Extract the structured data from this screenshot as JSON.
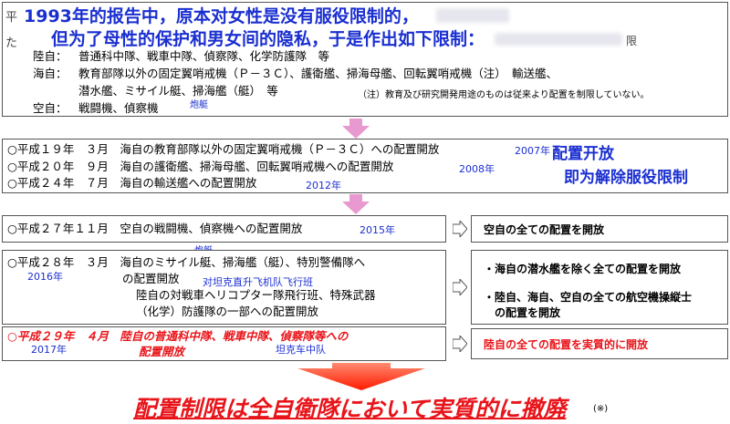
{
  "header": {
    "line1_prefix": "平",
    "line1": "1993年的报告中，原本对女性是没有服役限制的，",
    "line2_prefix": "た",
    "line2": "但为了母性的保护和男女间的隐私，于是作出如下限制：",
    "line2_suffix": "限"
  },
  "restrictions": [
    {
      "branch": "陸自：",
      "text": "普通科中隊、戦車中隊、偵察隊、化学防護隊　等"
    },
    {
      "branch": "海自：",
      "text": "教育部隊以外の固定翼哨戒機（Ｐ－３Ｃ）、護衛艦、掃海母艦、回転翼哨戒機（注）　輸送艦、"
    },
    {
      "branch": "",
      "text": "潜水艦、ミサイル艇、掃海艦（艇）　等"
    },
    {
      "branch": "空自：",
      "text": "戦闘機、偵察機"
    }
  ],
  "restriction_note": "（注）教育及び研究開発用途のものは従来より配置を制限していない。",
  "annotation_hoting1": "炮艇",
  "phase1": {
    "items": [
      {
        "label": "○平成１９年　３月　海自の教育部隊以外の固定翼哨戒機（Ｐ－３Ｃ）への配置開放",
        "year": "2007年"
      },
      {
        "label": "○平成２０年　９月　海自の護衛艦、掃海母艦、回転翼哨戒機への配置開放",
        "year": "2008年"
      },
      {
        "label": "○平成２４年　７月　海自の輸送艦への配置開放",
        "year": "2012年"
      }
    ],
    "annotation_line1": "配置开放",
    "annotation_line2": "即为解除服役限制"
  },
  "phase2": {
    "label": "○平成２７年１１月　空自の戦闘機、偵察機への配置開放",
    "year": "2015年",
    "result": "空自の全ての配置を開放"
  },
  "phase3": {
    "annotation_hoting": "炮艇",
    "line1": "○平成２８年　３月　海自のミサイル艇、掃海艦（艇）、特別警備隊へ",
    "year": "2016年",
    "line2": "の配置開放",
    "line2_annotation": "对坦克直升飞机队飞行班",
    "line3": "陸自の対戦車ヘリコプター隊飛行班、特殊武器",
    "line4": "（化学）防護隊の一部への配置開放",
    "result1": "・海自の潜水艦を除く全ての配置を開放",
    "result2": "・陸自、海自、空自の全ての航空機操縦士",
    "result3": "の配置を開放"
  },
  "phase4": {
    "line1": "○平成２９年　４月　陸自の普通科中隊、戦車中隊、偵察隊等への",
    "year": "2017年",
    "line2": "配置開放",
    "line2_annotation": "坦克车中队",
    "result": "陸自の全ての配置を実質的に開放"
  },
  "conclusion": {
    "text": "配置制限は全自衛隊において実質的に撤廃",
    "note": "(※)"
  },
  "colors": {
    "blue": "#1a2fd0",
    "red": "#e8141a",
    "arrow_pink": "#e89ad0",
    "arrow_red": "#ff2200"
  }
}
